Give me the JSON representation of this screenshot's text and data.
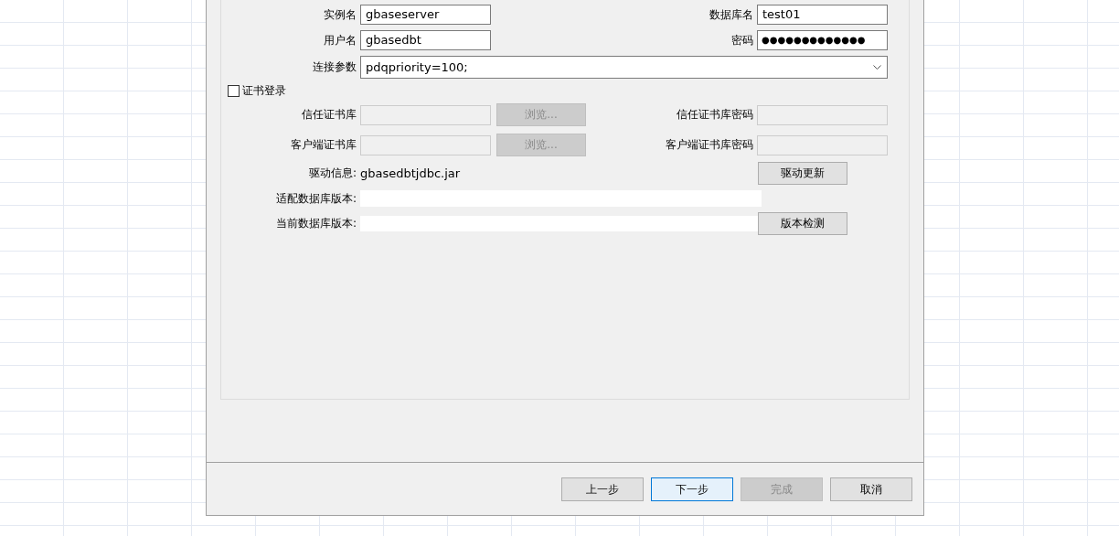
{
  "connection_fields": [
    {
      "label": "实例名",
      "value": "gbaseserver"
    },
    {
      "label": "数据库名",
      "value": "test01"
    },
    {
      "label": "用户名",
      "value": "gbasedbt"
    },
    {
      "label": "密码",
      "value": "●●●●●●●●●●●●●"
    }
  ],
  "connection_params": {
    "label": "连接参数",
    "value": "pdqpriority=100;"
  },
  "certificate_login": {
    "label": "证书登录",
    "checked": false
  },
  "certificate_stores": [
    {
      "label": "信任证书库",
      "browse_label": "浏览...",
      "password_label": "信任证书库密码",
      "disabled": true
    },
    {
      "label": "客户端证书库",
      "browse_label": "浏览...",
      "password_label": "客户端证书库密码",
      "disabled": true
    }
  ],
  "driver_info": {
    "label": "驱动信息:",
    "value": "gbasedbtjdbc.jar",
    "button": "驱动更新"
  },
  "version_rows": [
    {
      "label": "适配数据库版本:"
    },
    {
      "label": "当前数据库版本:",
      "button": "版本检测"
    }
  ],
  "buttons": [
    {
      "label": "上一步",
      "disabled": false,
      "focused": false
    },
    {
      "label": "下一步",
      "disabled": false,
      "focused": true
    },
    {
      "label": "完成",
      "disabled": true,
      "focused": false
    },
    {
      "label": "取消",
      "disabled": false,
      "focused": false
    }
  ]
}
